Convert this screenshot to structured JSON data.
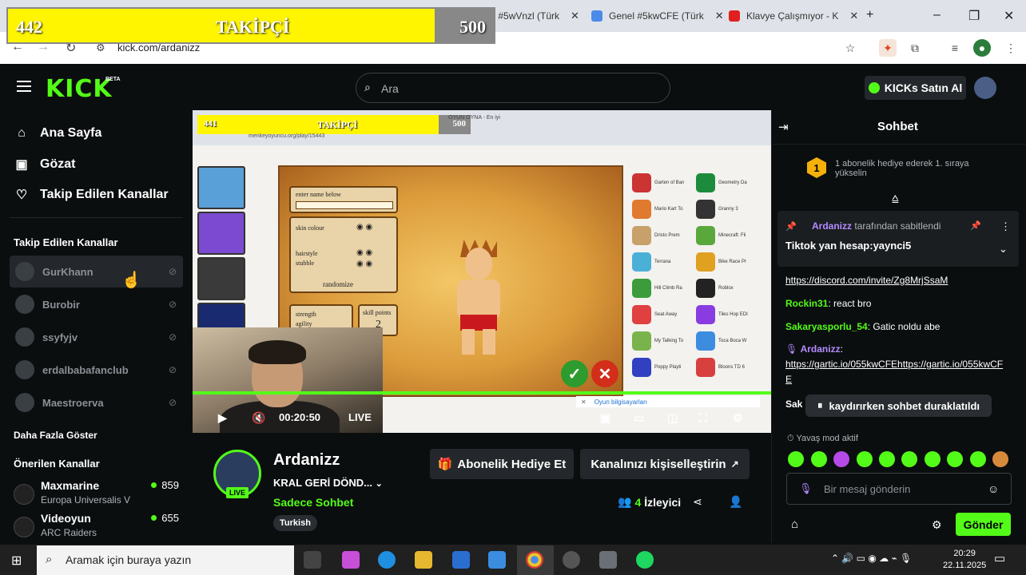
{
  "overlay": {
    "follower_count": "442",
    "title": "TAKİPÇİ",
    "goal": "500"
  },
  "browser": {
    "tabs": [
      {
        "label": "Genel #5wVnzl (Türk",
        "color": "#4a8ae8"
      },
      {
        "label": "Genel #5kwCFE (Türk",
        "color": "#4a8ae8"
      },
      {
        "label": "Klavye Çalışmıyor - K",
        "color": "#e02020"
      }
    ],
    "url": "kick.com/ardanizz"
  },
  "header": {
    "logo": "KICK",
    "beta": "BETA",
    "search_placeholder": "Ara",
    "kicks_button": "KICKs Satın Al"
  },
  "sidebar": {
    "nav": [
      {
        "label": "Ana Sayfa",
        "icon": "home-icon"
      },
      {
        "label": "Gözat",
        "icon": "browse-icon"
      },
      {
        "label": "Takip Edilen Kanallar",
        "icon": "heart-icon"
      }
    ],
    "followed_heading": "Takip Edilen Kanallar",
    "followed": [
      "GurKhann",
      "Burobir",
      "ssyfyjv",
      "erdalbabafanclub",
      "Maestroerva"
    ],
    "show_more": "Daha Fazla Göster",
    "recommended_heading": "Önerilen Kanallar",
    "recommended": [
      {
        "name": "Maxmarine",
        "game": "Europa Universalis V",
        "viewers": "859"
      },
      {
        "name": "Videoyun",
        "game": "ARC Raiders",
        "viewers": "655"
      }
    ]
  },
  "player": {
    "inner_follow_count": "441",
    "inner_follow_title": "TAKİPÇİ",
    "inner_follow_goal": "500",
    "inner_url": "menkeyoyuncu.org/play/15443",
    "inner_tab": "OYUN OYNA - En iyi",
    "game": {
      "name_field": "enter name below",
      "skin_colour": "skin colour",
      "hairstyle": "hairstyle",
      "stubble": "stubble",
      "randomize": "randomize",
      "strength": "strength",
      "agility": "agility",
      "skill_points": "skill points",
      "skill_points_value": "2"
    },
    "games_list": [
      "Garten of Ban",
      "Geometry Da",
      "Mario Kart To",
      "Granny 3",
      "Dristo Prem",
      "Minecraft: Fli",
      "Terrana",
      "Bike Race Pr",
      "Hill Climb Ra",
      "Roblox",
      "Seat Away",
      "Tiles Hop EDI",
      "My Talking To",
      "Toca Boca W",
      "Poppy Playti",
      "Bloons TD 6"
    ],
    "tooltip": "Oyun bilgisayarları",
    "time": "00:20:50",
    "live": "LIVE"
  },
  "channel": {
    "name": "Ardanizz",
    "live_tag": "LIVE",
    "title": "KRAL GERİ DÖND...",
    "category": "Sadece Sohbet",
    "language": "Turkish",
    "gift_button": "Abonelik Hediye Et",
    "customize_button": "Kanalınızı kişiselleştirin",
    "viewers": "4",
    "viewers_label": "İzleyici"
  },
  "chat": {
    "title": "Sohbet",
    "gift_rank": "1",
    "gift_notice": "1 abonelik hediye ederek 1. sıraya yükselin",
    "pinned_by_user": "Ardanizz",
    "pinned_by_suffix": "tarafından sabitlendi",
    "pinned_text": "Tiktok yan hesap:yaynci5",
    "messages": [
      {
        "user": "",
        "text": "https://discord.com/invite/Zg8MrjSsaM",
        "color": "#ffffff",
        "link": true
      },
      {
        "user": "Rockin31",
        "text": "react bro",
        "color": "#53fc18"
      },
      {
        "user": "Sakaryasporlu_54",
        "text": "Gatic noldu abe",
        "color": "#53fc18"
      },
      {
        "user": "Ardanizz",
        "text": "",
        "color": "#b38bff"
      },
      {
        "user": "",
        "text": "https://gartic.io/055kwCFEhttps://gartic.io/055kwCFE",
        "color": "#ffffff",
        "link": true
      }
    ],
    "partial_user": "Sak",
    "paused": "kaydırırken sohbet duraklatıldı",
    "slow_mode": "Yavaş mod aktif",
    "input_placeholder": "Bir mesaj gönderin",
    "send": "Gönder"
  },
  "taskbar": {
    "search": "Aramak için buraya yazın",
    "time": "20:29",
    "date": "22.11.2025"
  }
}
